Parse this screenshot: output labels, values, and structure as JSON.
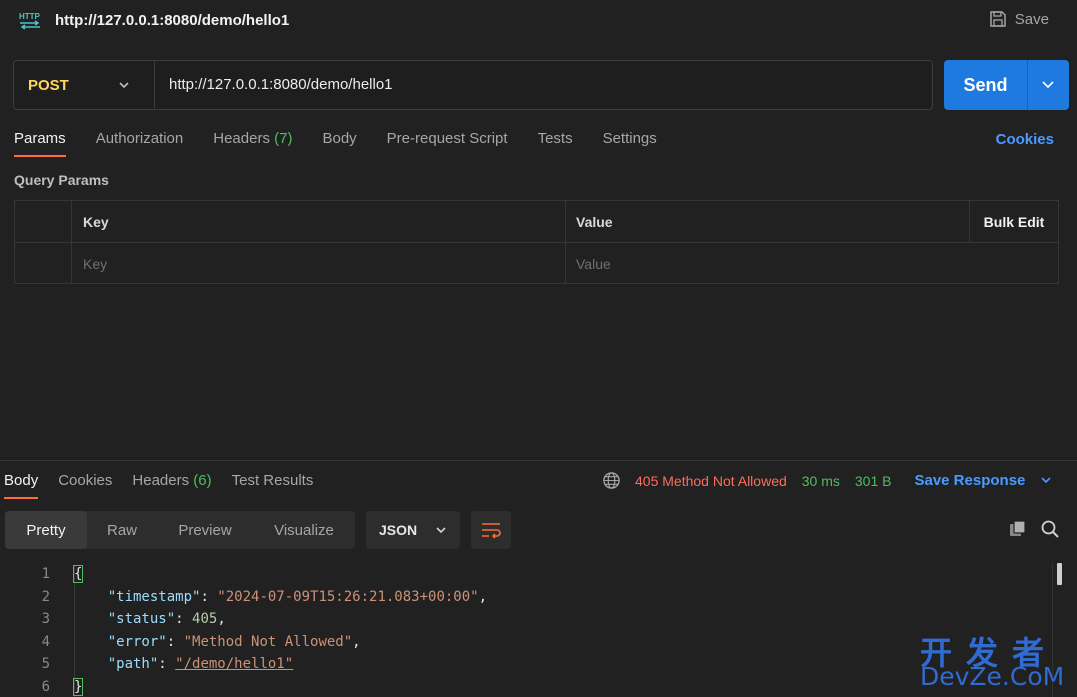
{
  "header": {
    "title": "http://127.0.0.1:8080/demo/hello1",
    "save_label": "Save",
    "http_icon_text": "HTTP"
  },
  "request": {
    "method": "POST",
    "url": "http://127.0.0.1:8080/demo/hello1",
    "send_label": "Send"
  },
  "tabs": [
    {
      "label": "Params",
      "count": ""
    },
    {
      "label": "Authorization",
      "count": ""
    },
    {
      "label": "Headers",
      "count": "(7)"
    },
    {
      "label": "Body",
      "count": ""
    },
    {
      "label": "Pre-request Script",
      "count": ""
    },
    {
      "label": "Tests",
      "count": ""
    },
    {
      "label": "Settings",
      "count": ""
    }
  ],
  "cookies_label": "Cookies",
  "query_params": {
    "label": "Query Params",
    "columns": {
      "key": "Key",
      "value": "Value",
      "bulk_edit": "Bulk Edit"
    },
    "placeholders": {
      "key": "Key",
      "value": "Value"
    }
  },
  "response": {
    "tabs": [
      {
        "label": "Body",
        "count": ""
      },
      {
        "label": "Cookies",
        "count": ""
      },
      {
        "label": "Headers",
        "count": "(6)"
      },
      {
        "label": "Test Results",
        "count": ""
      }
    ],
    "status": "405 Method Not Allowed",
    "time": "30 ms",
    "size": "301 B",
    "save_response": "Save Response",
    "views": [
      "Pretty",
      "Raw",
      "Preview",
      "Visualize"
    ],
    "format": "JSON",
    "lines": {
      "open": "{",
      "timestamp_key": "\"timestamp\"",
      "timestamp_val": "\"2024-07-09T15:26:21.083+00:00\"",
      "status_key": "\"status\"",
      "status_val": "405",
      "error_key": "\"error\"",
      "error_val": "\"Method Not Allowed\"",
      "path_key": "\"path\"",
      "path_val": "\"/demo/hello1\"",
      "close": "}"
    },
    "line_numbers": [
      "1",
      "2",
      "3",
      "4",
      "5",
      "6"
    ]
  },
  "watermark": {
    "cn": "开发者",
    "en": "DevZe.CoM"
  },
  "colors": {
    "accent": "#ff6c37",
    "send": "#1f7ae0",
    "method": "#ffd75e",
    "error": "#ff6b5e",
    "ok": "#4cbf60",
    "link": "#4a9bff"
  }
}
